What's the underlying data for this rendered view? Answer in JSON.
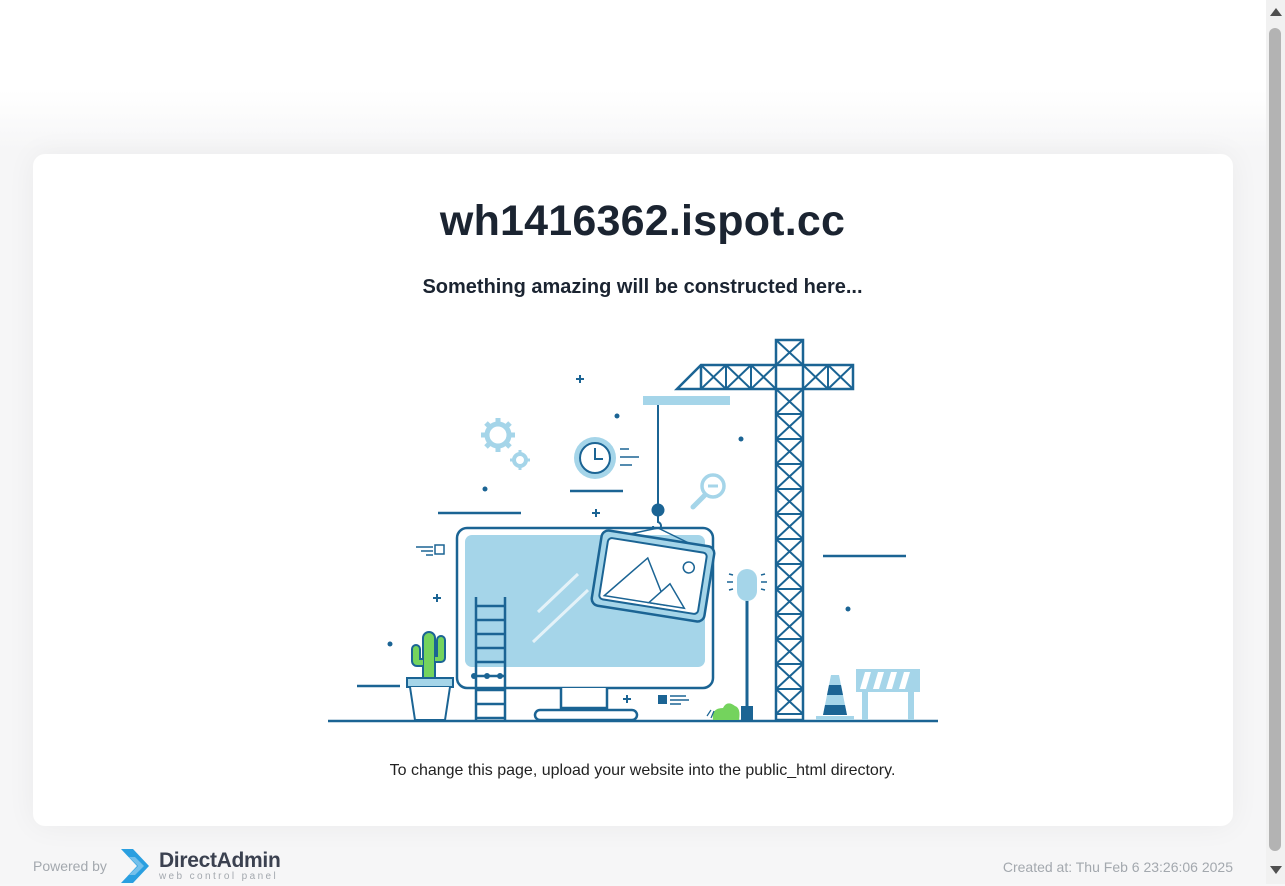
{
  "site": {
    "title": "wh1416362.ispot.cc",
    "tagline": "Something amazing will be constructed here...",
    "hint": "To change this page, upload your website into the public_html directory."
  },
  "footer": {
    "powered_by": "Powered by",
    "brand": "DirectAdmin",
    "brand_sub": "web control panel",
    "created": "Created at: Thu Feb 6 23:26:06 2025"
  },
  "colors": {
    "dark_blue": "#1b6494",
    "light_blue": "#a5d5e9",
    "text": "#1b2431",
    "green": "#74d35d"
  },
  "illustration": {
    "icons": [
      "gear-icon",
      "clock-icon",
      "magnifier-icon",
      "crane-icon",
      "monitor-icon",
      "picture-icon",
      "ladder-icon",
      "cactus-icon",
      "lamp-icon",
      "traffic-cone-icon",
      "barrier-icon"
    ]
  }
}
